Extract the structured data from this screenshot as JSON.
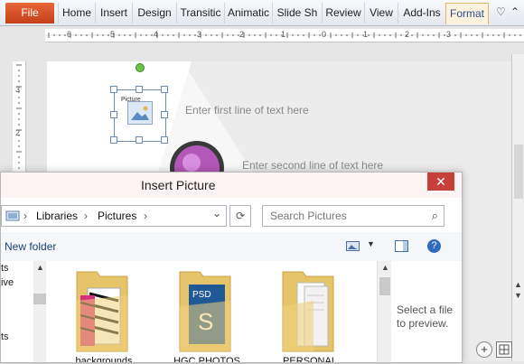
{
  "ribbon": {
    "file_tab": "File",
    "tabs": [
      {
        "label": "Home"
      },
      {
        "label": "Insert"
      },
      {
        "label": "Design"
      },
      {
        "label": "Transitic"
      },
      {
        "label": "Animatic"
      },
      {
        "label": "Slide Sh"
      },
      {
        "label": "Review"
      },
      {
        "label": "View"
      },
      {
        "label": "Add-Ins"
      },
      {
        "label": "Format"
      }
    ],
    "heart_icon": "♡",
    "chevron_icon": "⌃",
    "help_icon": "?"
  },
  "ruler": {
    "h_labels": [
      "6",
      "5",
      "4",
      "3",
      "2",
      "1",
      "0",
      "1",
      "2",
      "3"
    ],
    "v_labels": [
      "3",
      "2",
      "1",
      "2"
    ]
  },
  "slide": {
    "line1": "Enter first line of text here",
    "line2": "Enter second line of text here",
    "placeholder_label": "Picture"
  },
  "dialog": {
    "title": "Insert Picture",
    "close": "✕",
    "address": {
      "breadcrumbs": [
        {
          "label": "Libraries"
        },
        {
          "label": "Pictures"
        }
      ],
      "separator": "›",
      "dropdown": "⌄"
    },
    "refresh_icon": "⟳",
    "search": {
      "placeholder": "Search Pictures",
      "icon": "⌕"
    },
    "toolbar": {
      "new_folder": "New folder",
      "help": "?"
    },
    "nav_items": [
      "ts",
      "ive",
      "",
      "ts"
    ],
    "folders": [
      {
        "label": "backgrounds"
      },
      {
        "label": "HGC PHOTOS"
      },
      {
        "label": "PERSONAL"
      }
    ],
    "preview_text": "Select a file to preview."
  },
  "colors": {
    "file_tab": "#d24726",
    "close": "#c7403a",
    "accent": "#2b579a"
  }
}
